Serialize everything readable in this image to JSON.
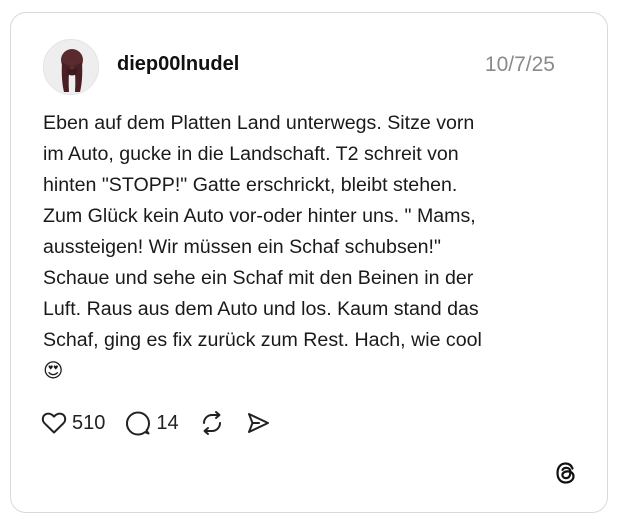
{
  "post": {
    "username": "diep00lnudel",
    "date": "10/7/25",
    "text_lines": [
      "Eben auf dem Platten Land unterwegs. Sitze vorn",
      "im Auto, gucke in die Landschaft. T2 schreit von",
      "hinten \"STOPP!\" Gatte erschrickt, bleibt stehen.",
      "Zum Glück kein Auto vor-oder hinter uns. \" Mams,",
      "aussteigen! Wir müssen ein Schaf schubsen!\"",
      "Schaue und sehe ein Schaf mit den Beinen in der",
      "Luft. Raus aus dem Auto und los. Kaum stand das",
      "Schaf, ging es fix zurück zum Rest. Hach, wie cool",
      "😍"
    ],
    "likes": "510",
    "replies": "14"
  },
  "icons": {
    "like": "heart-icon",
    "reply": "speech-bubble-icon",
    "repost": "repost-icon",
    "share": "send-icon",
    "brand": "threads-logo-icon"
  }
}
